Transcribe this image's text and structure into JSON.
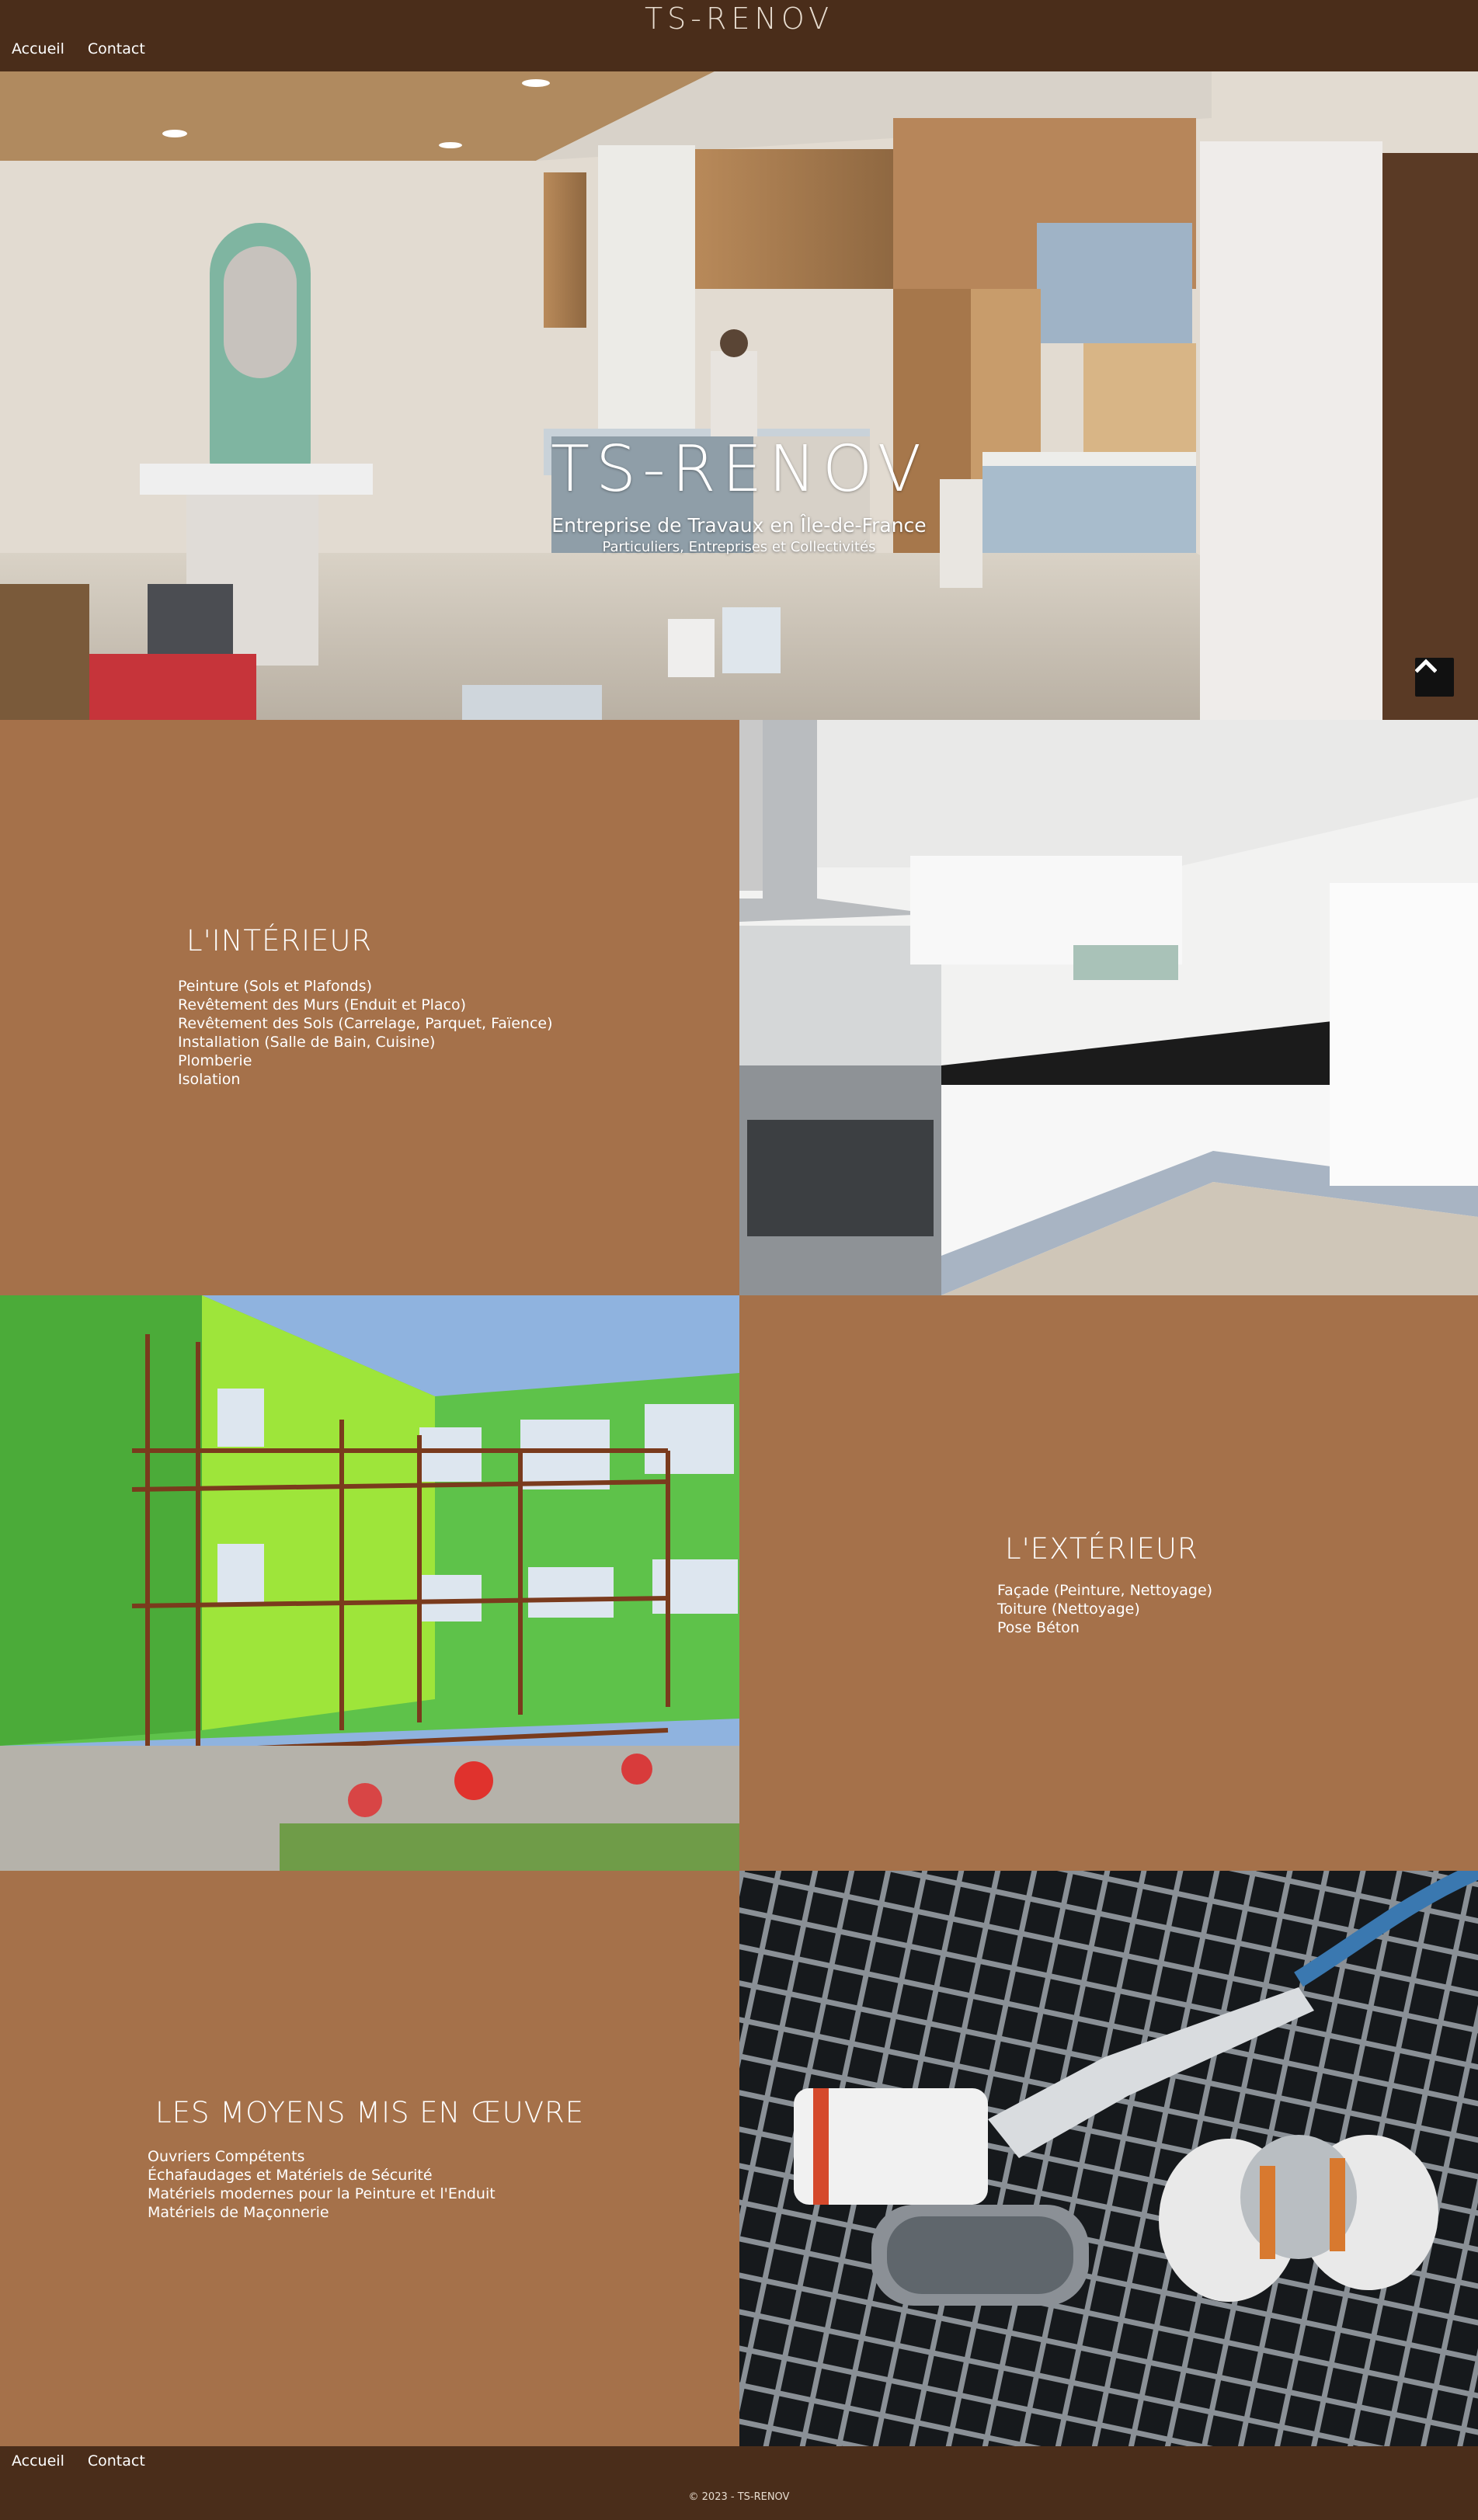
{
  "header": {
    "site_title": "TS-RENOV",
    "nav": {
      "home": "Accueil",
      "contact": "Contact"
    }
  },
  "hero": {
    "title": "TS-RENOV",
    "subtitle": "Entreprise de Travaux en Île-de-France",
    "tagline": "Particuliers, Entreprises et Collectivités",
    "scroll_top_icon": "chevron-up-icon"
  },
  "interior": {
    "heading": "L'INTÉRIEUR",
    "items": [
      "Peinture (Sols et Plafonds)",
      "Revêtement des Murs (Enduit et Placo)",
      "Revêtement des Sols (Carrelage, Parquet, Faïence)",
      "Installation (Salle de Bain, Cuisine)",
      "Plomberie",
      "Isolation"
    ]
  },
  "exterior": {
    "heading": "L'EXTÉRIEUR",
    "items": [
      "Façade (Peinture, Nettoyage)",
      "Toiture (Nettoyage)",
      "Pose Béton"
    ]
  },
  "means": {
    "heading": "LES MOYENS MIS EN ŒUVRE",
    "items": [
      "Ouvriers Compétents",
      "Échafaudages et Matériels de Sécurité",
      "Matériels modernes pour la Peinture et l'Enduit",
      "Matériels de Maçonnerie"
    ]
  },
  "footer": {
    "nav": {
      "home": "Accueil",
      "contact": "Contact"
    },
    "copyright": "© 2023 - TS-RENOV"
  },
  "colors": {
    "header_bg": "#4a2d1a",
    "panel_bg": "#a5714a",
    "text": "#ffffff"
  }
}
